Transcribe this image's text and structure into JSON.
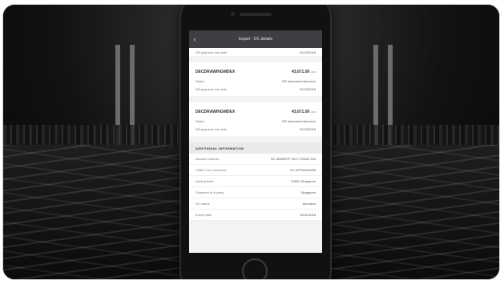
{
  "navbar": {
    "title": "Export - DC details",
    "back_icon": "chevron-left-icon"
  },
  "top_row": {
    "label": "DR payment due date",
    "value": "01/10/2016"
  },
  "drawings": [
    {
      "reference": "DECDRAWINGMDEX",
      "amount": "43,671.00",
      "currency": "HKD",
      "rows": [
        {
          "label": "Status",
          "value": "DR authorised and sent"
        },
        {
          "label": "DR payment due date",
          "value": "01/10/2016"
        }
      ]
    },
    {
      "reference": "DECDRAWINGMDEX",
      "amount": "43,671.00",
      "currency": "HKD",
      "rows": [
        {
          "label": "Status",
          "value": "DR authorised and sent"
        },
        {
          "label": "DR payment due date",
          "value": "01/10/2016"
        }
      ]
    }
  ],
  "additional": {
    "heading": "ADDITIONAL INFORMATION",
    "rows": [
      {
        "label": "Account number",
        "value": "DC MNMEXP 2017 CSA09 234"
      },
      {
        "label": "HSBC's DC reference",
        "value": "DC MYRA000005"
      },
      {
        "label": "Issuing bank",
        "value": "HSBC Singapore"
      },
      {
        "label": "Shipment to country",
        "value": "Singapore"
      },
      {
        "label": "DC status",
        "value": "Allocated"
      },
      {
        "label": "Expiry date",
        "value": "30/11/2016"
      }
    ]
  }
}
